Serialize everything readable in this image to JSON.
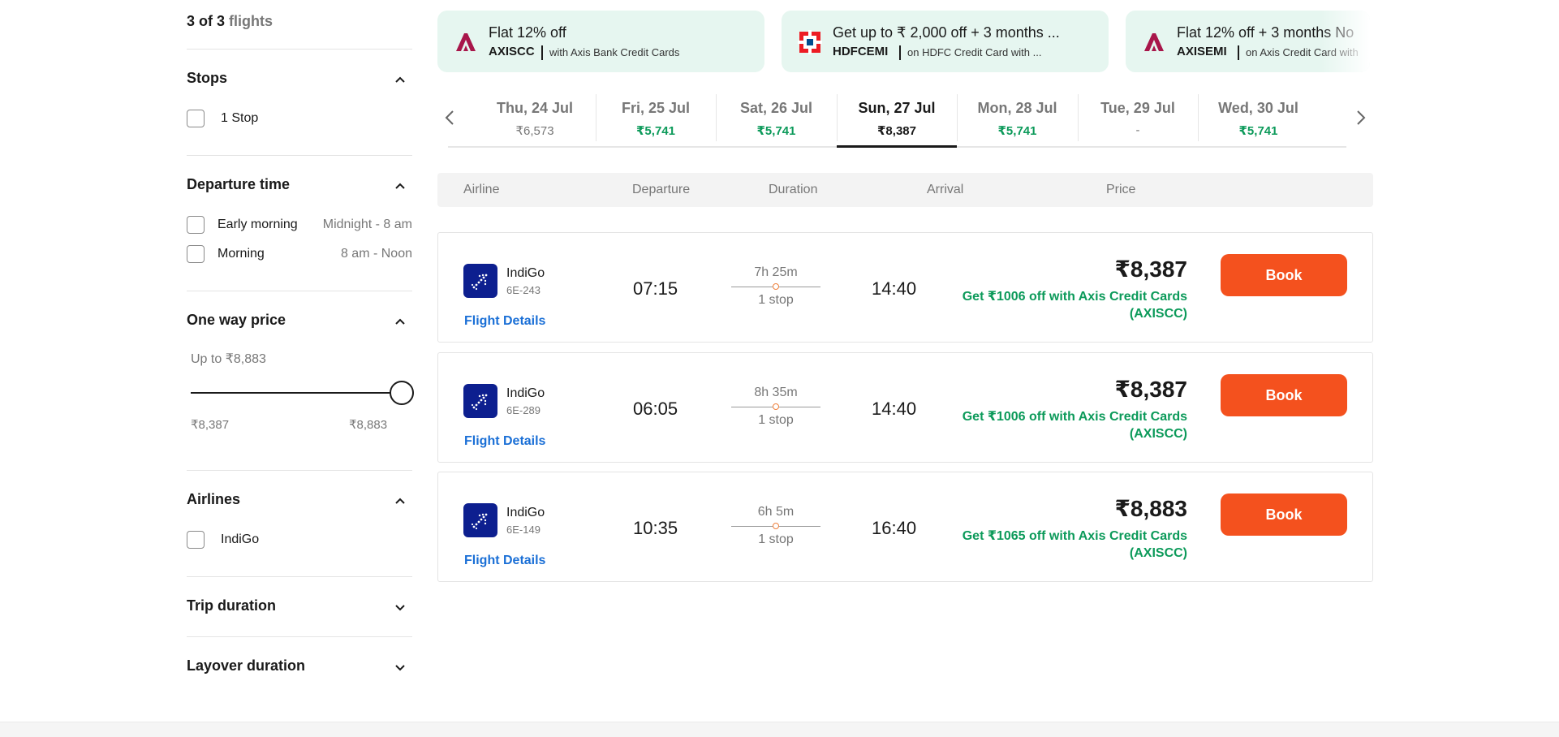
{
  "results": {
    "count_prefix": "3 of 3",
    "count_suffix": "flights"
  },
  "filters": {
    "stops": {
      "title": "Stops",
      "options": [
        "1 Stop"
      ]
    },
    "departure_time": {
      "title": "Departure time",
      "options": [
        {
          "label": "Early morning",
          "range": "Midnight - 8 am"
        },
        {
          "label": "Morning",
          "range": "8 am - Noon"
        }
      ]
    },
    "one_way_price": {
      "title": "One way price",
      "up_to": "Up to ₹8,883",
      "min": "₹8,387",
      "max": "₹8,883",
      "selected_fraction": 1.0
    },
    "airlines": {
      "title": "Airlines",
      "options": [
        "IndiGo"
      ]
    },
    "trip_duration": {
      "title": "Trip duration"
    },
    "layover_duration": {
      "title": "Layover duration"
    }
  },
  "offers": [
    {
      "title": "Flat 12% off",
      "code": "AXISCC",
      "desc": "with Axis Bank Credit Cards",
      "icon": "axis-bank-icon"
    },
    {
      "title": "Get up to ₹ 2,000 off + 3 months ...",
      "code": "HDFCEMI",
      "desc": "on HDFC Credit Card with ...",
      "icon": "hdfc-bank-icon"
    },
    {
      "title": "Flat 12% off + 3 months No",
      "code": "AXISEMI",
      "desc": "on Axis Credit Card with",
      "icon": "axis-bank-icon"
    }
  ],
  "dates": [
    {
      "day": "Thu, 24 Jul",
      "price": "₹6,573",
      "cheap": false,
      "active": false
    },
    {
      "day": "Fri, 25 Jul",
      "price": "₹5,741",
      "cheap": true,
      "active": false
    },
    {
      "day": "Sat, 26 Jul",
      "price": "₹5,741",
      "cheap": true,
      "active": false
    },
    {
      "day": "Sun, 27 Jul",
      "price": "₹8,387",
      "cheap": false,
      "active": true
    },
    {
      "day": "Mon, 28 Jul",
      "price": "₹5,741",
      "cheap": true,
      "active": false
    },
    {
      "day": "Tue, 29 Jul",
      "price": "-",
      "cheap": false,
      "active": false
    },
    {
      "day": "Wed, 30 Jul",
      "price": "₹5,741",
      "cheap": true,
      "active": false
    }
  ],
  "table_headers": {
    "airline": "Airline",
    "departure": "Departure",
    "duration": "Duration",
    "arrival": "Arrival",
    "price": "Price"
  },
  "flights": [
    {
      "airline": "IndiGo",
      "code": "6E-243",
      "details": "Flight Details",
      "departure": "07:15",
      "duration": "7h 25m",
      "stops": "1 stop",
      "arrival": "14:40",
      "price": "₹8,387",
      "offer": "Get ₹1006 off with Axis Credit Cards (AXISCC)",
      "book": "Book"
    },
    {
      "airline": "IndiGo",
      "code": "6E-289",
      "details": "Flight Details",
      "departure": "06:05",
      "duration": "8h 35m",
      "stops": "1 stop",
      "arrival": "14:40",
      "price": "₹8,387",
      "offer": "Get ₹1006 off with Axis Credit Cards (AXISCC)",
      "book": "Book"
    },
    {
      "airline": "IndiGo",
      "code": "6E-149",
      "details": "Flight Details",
      "departure": "10:35",
      "duration": "6h 5m",
      "stops": "1 stop",
      "arrival": "16:40",
      "price": "₹8,883",
      "offer": "Get ₹1065 off with Axis Credit Cards (AXISCC)",
      "book": "Book"
    }
  ],
  "colors": {
    "accent": "#f4511e",
    "green": "#0c9a5a",
    "link": "#1a6fd6",
    "indigo": "#0d1f8f"
  }
}
